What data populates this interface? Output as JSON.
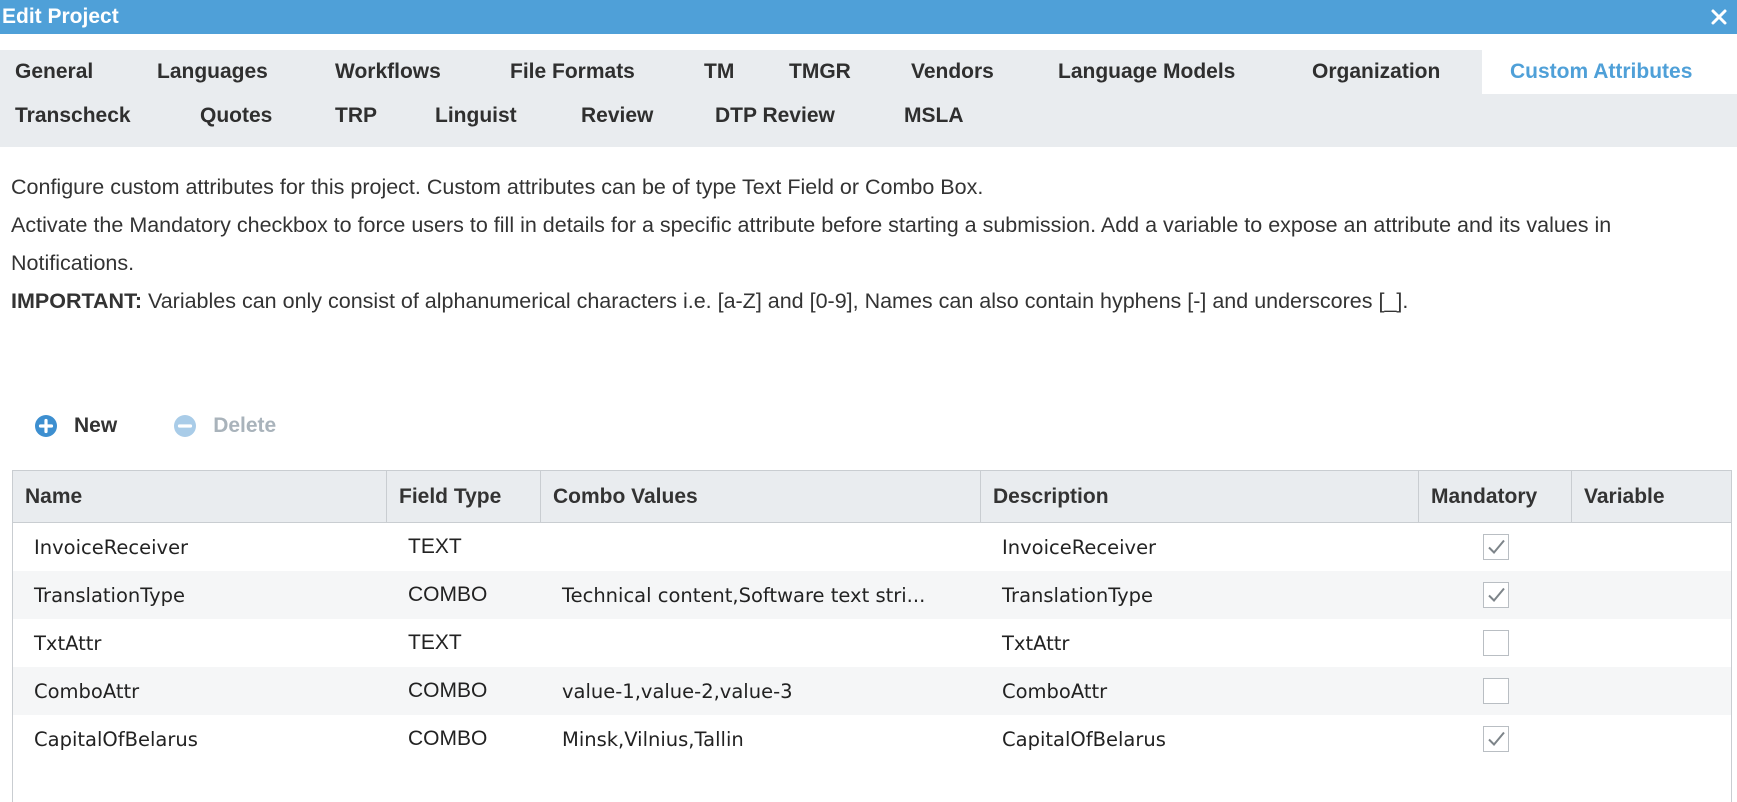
{
  "window": {
    "title": "Edit Project"
  },
  "tabs_row1": [
    {
      "label": "General"
    },
    {
      "label": "Languages"
    },
    {
      "label": "Workflows"
    },
    {
      "label": "File Formats"
    },
    {
      "label": "TM"
    },
    {
      "label": "TMGR"
    },
    {
      "label": "Vendors"
    },
    {
      "label": "Language Models"
    },
    {
      "label": "Organization"
    },
    {
      "label": "Custom Attributes"
    }
  ],
  "tabs_row2": [
    {
      "label": "Transcheck"
    },
    {
      "label": "Quotes"
    },
    {
      "label": "TRP"
    },
    {
      "label": "Linguist"
    },
    {
      "label": "Review"
    },
    {
      "label": "DTP Review"
    },
    {
      "label": "MSLA"
    }
  ],
  "active_tab": "Custom Attributes",
  "description": {
    "line1": "Configure custom attributes for this project. Custom attributes can be of type Text Field or Combo Box.",
    "line2": "Activate the Mandatory checkbox to force users to fill in details for a specific attribute before starting a submission. Add a variable to expose an attribute and its values in Notifications.",
    "important_label": "IMPORTANT:",
    "important_text": " Variables can only consist of alphanumerical characters i.e. [a-Z] and [0-9], Names can also contain hyphens [-] and underscores [_]."
  },
  "toolbar": {
    "new_label": "New",
    "delete_label": "Delete"
  },
  "grid": {
    "columns": [
      "Name",
      "Field Type",
      "Combo Values",
      "Description",
      "Mandatory",
      "Variable"
    ],
    "rows": [
      {
        "name": "InvoiceReceiver",
        "type": "TEXT",
        "combo": "",
        "description": "InvoiceReceiver",
        "mandatory": true,
        "variable": ""
      },
      {
        "name": "TranslationType",
        "type": "COMBO",
        "combo": "Technical content,Software text stri...",
        "description": "TranslationType",
        "mandatory": true,
        "variable": ""
      },
      {
        "name": "TxtAttr",
        "type": "TEXT",
        "combo": "",
        "description": "TxtAttr",
        "mandatory": false,
        "variable": ""
      },
      {
        "name": "ComboAttr",
        "type": "COMBO",
        "combo": "value-1,value-2,value-3",
        "description": "ComboAttr",
        "mandatory": false,
        "variable": ""
      },
      {
        "name": "CapitalOfBelarus",
        "type": "COMBO",
        "combo": "Minsk,Vilnius,Tallin",
        "description": "CapitalOfBelarus",
        "mandatory": true,
        "variable": ""
      }
    ]
  },
  "colors": {
    "accent": "#4fa0d8",
    "tabbar_bg": "#e9ecef",
    "disabled": "#a9b3bb"
  },
  "icons": {
    "close": "close-icon",
    "new": "plus-circle-icon",
    "delete": "minus-circle-icon",
    "check": "checkmark-icon"
  }
}
